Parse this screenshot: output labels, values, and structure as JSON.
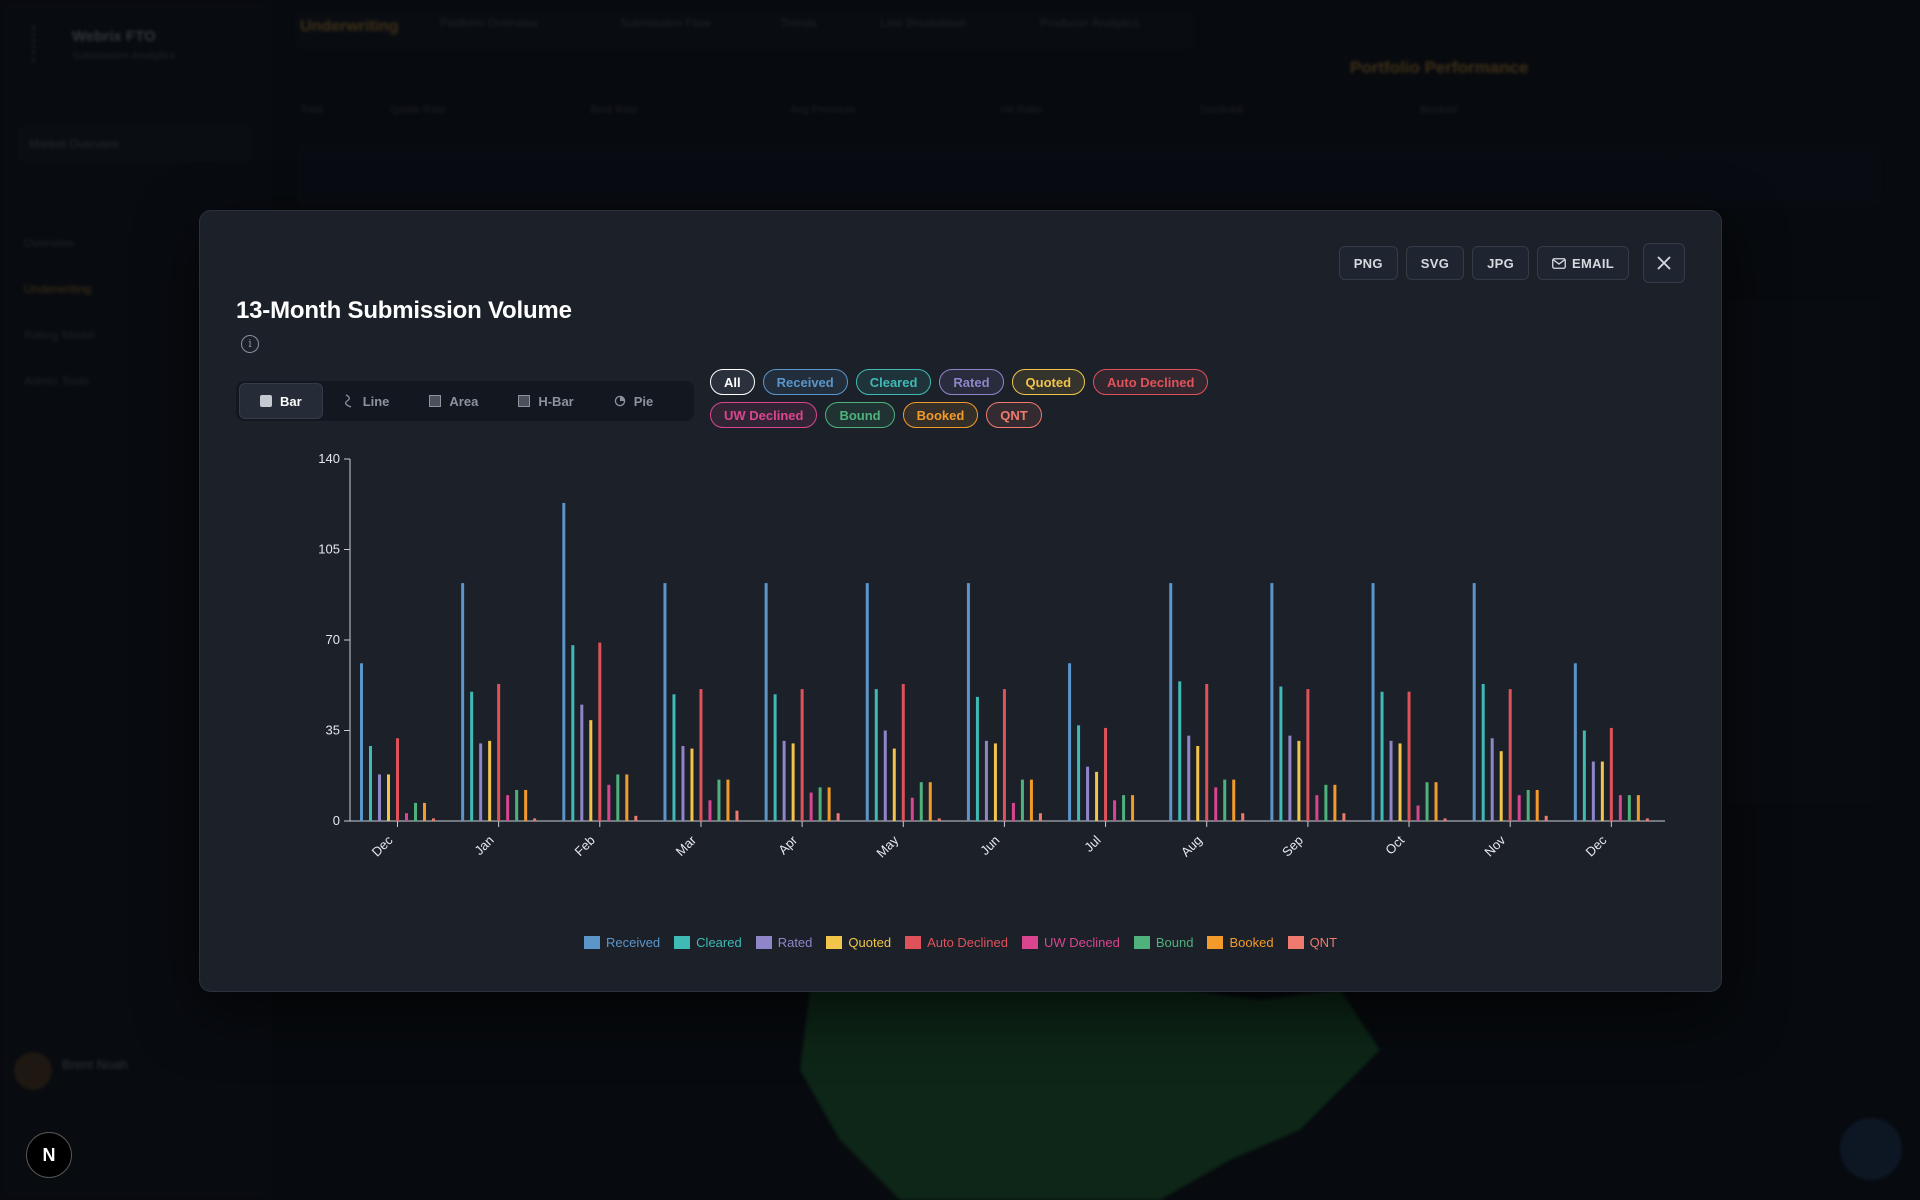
{
  "background": {
    "brand": "Webrix FTO",
    "brand_sub": "Submission Analytics",
    "top_title": "Underwriting",
    "top_tabs": [
      "Platform Overview",
      "Submission Flow",
      "Trends",
      "Line Breakdown",
      "Producer Analytics"
    ],
    "nav": [
      "Overview",
      "Underwriting",
      "Rating Model",
      "Admin Tools"
    ],
    "select_value": "Market Overview",
    "metrics": [
      {
        "label": "Total",
        "value": ""
      },
      {
        "label": "Quote Rate",
        "value": ""
      },
      {
        "label": "Bind Rate",
        "value": ""
      },
      {
        "label": "Avg Premium",
        "value": ""
      },
      {
        "label": "Hit Ratio",
        "value": ""
      },
      {
        "label": "Declined",
        "value": ""
      },
      {
        "label": "Booked",
        "value": ""
      }
    ],
    "username": "Brent Noah",
    "next_badge": "N",
    "orange_heading": "Portfolio Performance"
  },
  "modal": {
    "title": "13-Month Submission Volume",
    "info_icon": "info-circle-icon",
    "export_buttons": [
      "PNG",
      "SVG",
      "JPG",
      "EMAIL"
    ],
    "close_icon": "close-icon",
    "chart_types": [
      {
        "label": "Bar",
        "icon": "bar-chart-icon",
        "active": true
      },
      {
        "label": "Line",
        "icon": "line-chart-icon",
        "active": false
      },
      {
        "label": "Area",
        "icon": "area-chart-icon",
        "active": false
      },
      {
        "label": "H-Bar",
        "icon": "hbar-chart-icon",
        "active": false
      },
      {
        "label": "Pie",
        "icon": "pie-chart-icon",
        "active": false
      }
    ],
    "filter_all": "All"
  },
  "chart_data": {
    "type": "bar",
    "title": "13-Month Submission Volume",
    "xlabel": "",
    "ylabel": "",
    "ylim": [
      0,
      140
    ],
    "yticks": [
      0,
      35,
      70,
      105,
      140
    ],
    "grid": false,
    "legend_position": "bottom",
    "categories": [
      "Dec",
      "Jan",
      "Feb",
      "Mar",
      "Apr",
      "May",
      "Jun",
      "Jul",
      "Aug",
      "Sep",
      "Oct",
      "Nov",
      "Dec"
    ],
    "series": [
      {
        "name": "Received",
        "color": "#5b95c9",
        "values": [
          61,
          92,
          123,
          92,
          92,
          92,
          92,
          61,
          92,
          92,
          92,
          92,
          61
        ]
      },
      {
        "name": "Cleared",
        "color": "#3fbab5",
        "values": [
          29,
          50,
          68,
          49,
          49,
          51,
          48,
          37,
          54,
          52,
          50,
          53,
          35
        ]
      },
      {
        "name": "Rated",
        "color": "#8f86c9",
        "values": [
          18,
          30,
          45,
          29,
          31,
          35,
          31,
          21,
          33,
          33,
          31,
          32,
          23
        ]
      },
      {
        "name": "Quoted",
        "color": "#f2c44a",
        "values": [
          18,
          31,
          39,
          28,
          30,
          28,
          30,
          19,
          29,
          31,
          30,
          27,
          23
        ]
      },
      {
        "name": "Auto Declined",
        "color": "#e0525a",
        "values": [
          32,
          53,
          69,
          51,
          51,
          53,
          51,
          36,
          53,
          51,
          50,
          51,
          36
        ]
      },
      {
        "name": "UW Declined",
        "color": "#d9468f",
        "values": [
          3,
          10,
          14,
          8,
          11,
          9,
          7,
          8,
          13,
          10,
          6,
          10,
          10
        ]
      },
      {
        "name": "Bound",
        "color": "#4fb27d",
        "values": [
          7,
          12,
          18,
          16,
          13,
          15,
          16,
          10,
          16,
          14,
          15,
          12,
          10
        ]
      },
      {
        "name": "Booked",
        "color": "#f29b2a",
        "values": [
          7,
          12,
          18,
          16,
          13,
          15,
          16,
          10,
          16,
          14,
          15,
          12,
          10
        ]
      },
      {
        "name": "QNT",
        "color": "#f07a6e",
        "values": [
          1,
          1,
          2,
          4,
          3,
          1,
          3,
          0,
          3,
          3,
          1,
          2,
          1
        ]
      }
    ]
  }
}
